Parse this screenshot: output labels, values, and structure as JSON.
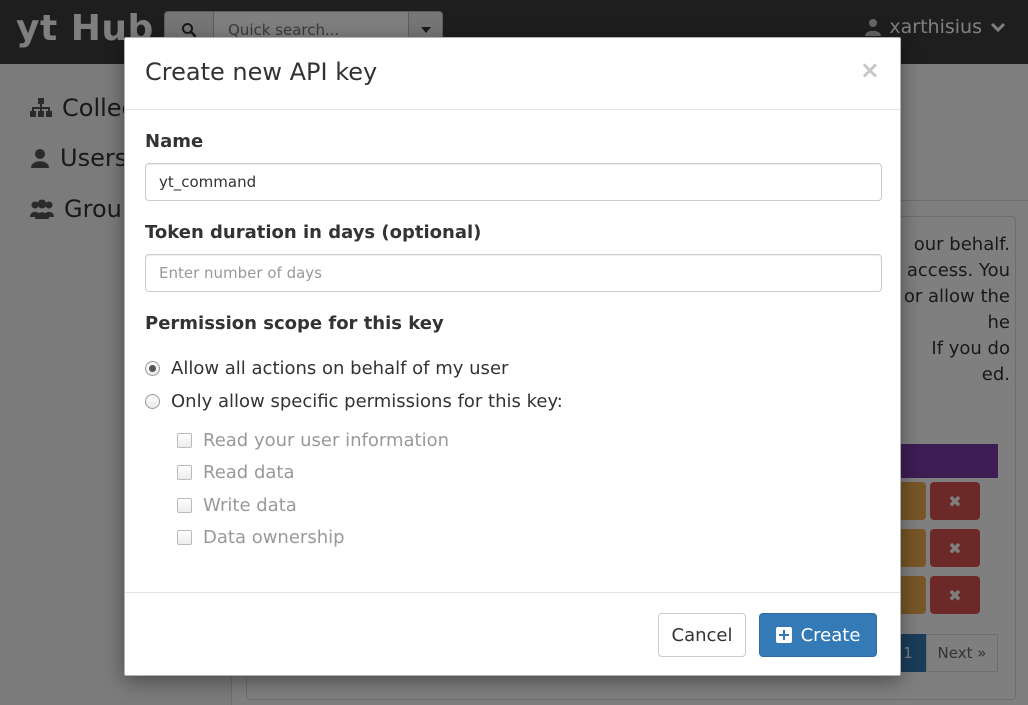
{
  "app": {
    "brand": "yt Hub"
  },
  "header": {
    "search_placeholder": "Quick search...",
    "username": "xarthisius"
  },
  "sidebar": {
    "items": [
      {
        "label": "Collect",
        "icon": "sitemap-icon"
      },
      {
        "label": "Users",
        "icon": "user-icon"
      },
      {
        "label": "Group",
        "icon": "users-icon"
      }
    ]
  },
  "background_panel": {
    "lines": [
      "our behalf.",
      "access. You",
      "or allow the",
      "he",
      "If you do",
      "ed."
    ],
    "pagination": {
      "current": "1",
      "next": "Next »"
    }
  },
  "modal": {
    "title": "Create new API key",
    "close_label": "×",
    "name": {
      "label": "Name",
      "value": "yt_command"
    },
    "duration": {
      "label": "Token duration in days (optional)",
      "placeholder": "Enter number of days",
      "value": ""
    },
    "scope": {
      "label": "Permission scope for this key",
      "options": [
        {
          "label": "Allow all actions on behalf of my user",
          "checked": true
        },
        {
          "label": "Only allow specific permissions for this key:",
          "checked": false
        }
      ],
      "permissions": [
        {
          "label": "Read your user information",
          "checked": false
        },
        {
          "label": "Read data",
          "checked": false
        },
        {
          "label": "Write data",
          "checked": false
        },
        {
          "label": "Data ownership",
          "checked": false
        }
      ]
    },
    "buttons": {
      "cancel": "Cancel",
      "create": "Create"
    }
  },
  "colors": {
    "primary": "#337ab7",
    "topbar": "#3c3c3c",
    "danger": "#d9534f",
    "warning": "#f0ad4e",
    "purple": "#7b3aa8"
  }
}
